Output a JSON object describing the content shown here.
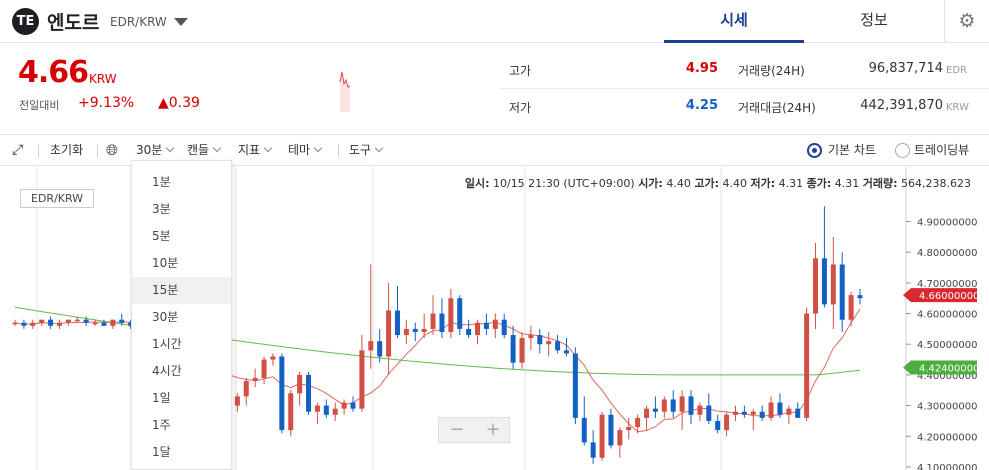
{
  "header": {
    "logo_glyph": "ΤΕ",
    "coin_name": "엔도르",
    "pair": "EDR/KRW",
    "tabs": [
      "시세",
      "정보"
    ],
    "settings_icon": "gear-icon"
  },
  "price": {
    "value": "4.66",
    "unit": "KRW",
    "change_label": "전일대비",
    "change_rate": "+9.13%",
    "change_amount": "▲0.39"
  },
  "stats": {
    "high_label": "고가",
    "high": "4.95",
    "low_label": "저가",
    "low": "4.25",
    "volume_label": "거래량(24H)",
    "volume": "96,837,714",
    "volume_unit": "EDR",
    "amount_label": "거래대금(24H)",
    "amount": "442,391,870",
    "amount_unit": "KRW"
  },
  "toolbar": {
    "reset": "초기화",
    "interval": "30분",
    "candle": "캔들",
    "indicator": "지표",
    "theme": "테마",
    "tools": "도구",
    "basic_chart": "기본 차트",
    "tradingview": "트레이딩뷰"
  },
  "ohlc": {
    "date_label": "일시:",
    "date": "10/15 21:30 (UTC+09:00)",
    "open_label": "시가:",
    "open": "4.40",
    "high_label": "고가:",
    "high": "4.40",
    "low_label": "저가:",
    "low": "4.31",
    "close_label": "종가:",
    "close": "4.31",
    "vol_label": "거래량:",
    "vol": "564,238.623"
  },
  "chart_pair": "EDR/KRW",
  "interval_menu": [
    "1분",
    "3분",
    "5분",
    "10분",
    "15분",
    "30분",
    "1시간",
    "4시간",
    "1일",
    "1주",
    "1달"
  ],
  "interval_menu_selected": 4,
  "colors": {
    "up": "#d24f45",
    "down": "#1261c4",
    "brand": "#1c3f95",
    "ma_short": "#e06a5a",
    "ma_long": "#5cbf4b"
  },
  "chart_data": {
    "type": "candlestick",
    "y_ticks": [
      "4.90000000",
      "4.80000000",
      "4.70000000",
      "4.60000000",
      "4.50000000",
      "4.40000000",
      "4.30000000",
      "4.20000000",
      "4.10000000"
    ],
    "ylim": [
      4.09,
      4.98
    ],
    "current_price_tag": "4.66000000",
    "ma_tag": "4.42400000",
    "candles": [
      [
        4.57,
        4.58,
        4.56,
        4.57
      ],
      [
        4.57,
        4.58,
        4.55,
        4.56
      ],
      [
        4.56,
        4.58,
        4.55,
        4.57
      ],
      [
        4.57,
        4.58,
        4.56,
        4.58
      ],
      [
        4.58,
        4.59,
        4.55,
        4.56
      ],
      [
        4.56,
        4.58,
        4.55,
        4.57
      ],
      [
        4.57,
        4.58,
        4.56,
        4.58
      ],
      [
        4.58,
        4.59,
        4.57,
        4.58
      ],
      [
        4.58,
        4.59,
        4.56,
        4.57
      ],
      [
        4.57,
        4.58,
        4.56,
        4.57
      ],
      [
        4.57,
        4.58,
        4.56,
        4.56
      ],
      [
        4.56,
        4.58,
        4.55,
        4.58
      ],
      [
        4.58,
        4.6,
        4.56,
        4.57
      ],
      [
        4.57,
        4.58,
        4.55,
        4.56
      ],
      [
        4.56,
        4.58,
        4.55,
        4.58
      ],
      [
        4.44,
        4.45,
        4.42,
        4.43
      ],
      [
        4.43,
        4.45,
        4.42,
        4.44
      ],
      [
        4.44,
        4.45,
        4.4,
        4.41
      ],
      [
        4.41,
        4.44,
        4.38,
        4.43
      ],
      [
        4.43,
        4.45,
        4.41,
        4.42
      ],
      [
        4.42,
        4.43,
        4.39,
        4.4
      ],
      [
        4.4,
        4.42,
        4.38,
        4.41
      ],
      [
        4.41,
        4.43,
        4.4,
        4.42
      ],
      [
        4.42,
        4.43,
        4.4,
        4.42
      ],
      [
        4.42,
        4.43,
        4.29,
        4.3
      ],
      [
        4.3,
        4.34,
        4.28,
        4.33
      ],
      [
        4.33,
        4.39,
        4.3,
        4.38
      ],
      [
        4.38,
        4.42,
        4.36,
        4.39
      ],
      [
        4.39,
        4.46,
        4.37,
        4.45
      ],
      [
        4.45,
        4.47,
        4.43,
        4.46
      ],
      [
        4.46,
        4.47,
        4.21,
        4.22
      ],
      [
        4.22,
        4.35,
        4.2,
        4.34
      ],
      [
        4.34,
        4.41,
        4.3,
        4.4
      ],
      [
        4.4,
        4.41,
        4.27,
        4.28
      ],
      [
        4.28,
        4.31,
        4.24,
        4.3
      ],
      [
        4.3,
        4.32,
        4.26,
        4.27
      ],
      [
        4.27,
        4.31,
        4.25,
        4.29
      ],
      [
        4.29,
        4.32,
        4.27,
        4.31
      ],
      [
        4.31,
        4.33,
        4.28,
        4.29
      ],
      [
        4.29,
        4.53,
        4.28,
        4.48
      ],
      [
        4.48,
        4.76,
        4.42,
        4.51
      ],
      [
        4.51,
        4.55,
        4.44,
        4.46
      ],
      [
        4.46,
        4.7,
        4.4,
        4.61
      ],
      [
        4.61,
        4.69,
        4.52,
        4.53
      ],
      [
        4.53,
        4.58,
        4.5,
        4.55
      ],
      [
        4.55,
        4.57,
        4.51,
        4.54
      ],
      [
        4.54,
        4.6,
        4.52,
        4.55
      ],
      [
        4.55,
        4.66,
        4.53,
        4.6
      ],
      [
        4.6,
        4.65,
        4.52,
        4.54
      ],
      [
        4.54,
        4.68,
        4.52,
        4.65
      ],
      [
        4.65,
        4.66,
        4.53,
        4.55
      ],
      [
        4.55,
        4.58,
        4.52,
        4.53
      ],
      [
        4.53,
        4.58,
        4.5,
        4.57
      ],
      [
        4.57,
        4.6,
        4.53,
        4.55
      ],
      [
        4.55,
        4.6,
        4.52,
        4.58
      ],
      [
        4.58,
        4.6,
        4.52,
        4.53
      ],
      [
        4.53,
        4.56,
        4.42,
        4.44
      ],
      [
        4.44,
        4.54,
        4.42,
        4.52
      ],
      [
        4.52,
        4.56,
        4.48,
        4.53
      ],
      [
        4.53,
        4.55,
        4.47,
        4.5
      ],
      [
        4.5,
        4.54,
        4.46,
        4.51
      ],
      [
        4.51,
        4.53,
        4.47,
        4.48
      ],
      [
        4.48,
        4.52,
        4.46,
        4.47
      ],
      [
        4.47,
        4.49,
        4.24,
        4.26
      ],
      [
        4.26,
        4.33,
        4.17,
        4.18
      ],
      [
        4.18,
        4.22,
        4.11,
        4.13
      ],
      [
        4.13,
        4.28,
        4.12,
        4.27
      ],
      [
        4.27,
        4.29,
        4.16,
        4.17
      ],
      [
        4.17,
        4.23,
        4.13,
        4.22
      ],
      [
        4.22,
        4.26,
        4.19,
        4.23
      ],
      [
        4.23,
        4.27,
        4.21,
        4.26
      ],
      [
        4.26,
        4.3,
        4.22,
        4.29
      ],
      [
        4.29,
        4.33,
        4.26,
        4.28
      ],
      [
        4.28,
        4.33,
        4.26,
        4.32
      ],
      [
        4.32,
        4.35,
        4.26,
        4.28
      ],
      [
        4.28,
        4.35,
        4.22,
        4.33
      ],
      [
        4.33,
        4.35,
        4.24,
        4.27
      ],
      [
        4.27,
        4.31,
        4.25,
        4.3
      ],
      [
        4.3,
        4.34,
        4.24,
        4.25
      ],
      [
        4.25,
        4.27,
        4.21,
        4.22
      ],
      [
        4.22,
        4.28,
        4.2,
        4.27
      ],
      [
        4.27,
        4.3,
        4.25,
        4.28
      ],
      [
        4.28,
        4.3,
        4.26,
        4.27
      ],
      [
        4.27,
        4.29,
        4.22,
        4.28
      ],
      [
        4.28,
        4.3,
        4.25,
        4.26
      ],
      [
        4.26,
        4.33,
        4.25,
        4.31
      ],
      [
        4.31,
        4.34,
        4.26,
        4.27
      ],
      [
        4.27,
        4.3,
        4.24,
        4.29
      ],
      [
        4.29,
        4.31,
        4.26,
        4.26
      ],
      [
        4.26,
        4.62,
        4.25,
        4.6
      ],
      [
        4.6,
        4.83,
        4.55,
        4.78
      ],
      [
        4.78,
        4.95,
        4.62,
        4.63
      ],
      [
        4.63,
        4.85,
        4.55,
        4.76
      ],
      [
        4.76,
        4.8,
        4.54,
        4.58
      ],
      [
        4.58,
        4.67,
        4.56,
        4.66
      ],
      [
        4.66,
        4.68,
        4.63,
        4.65
      ]
    ]
  }
}
